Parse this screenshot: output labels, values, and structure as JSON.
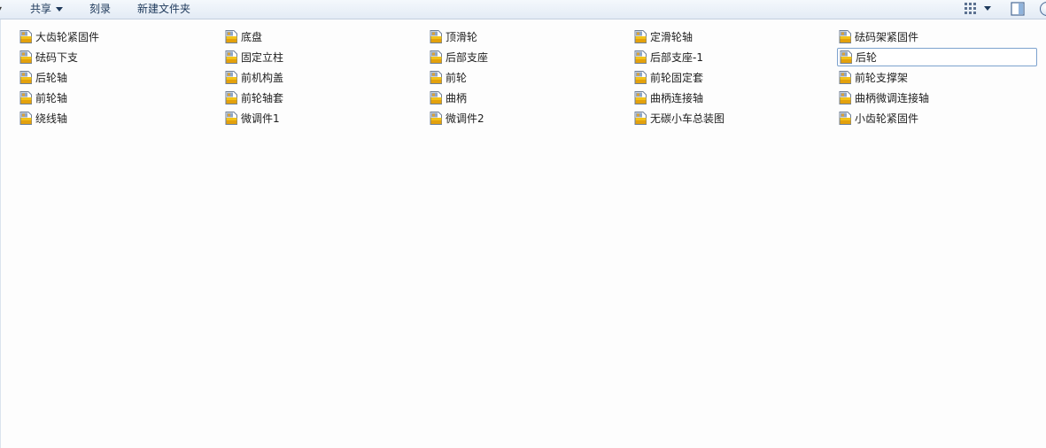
{
  "toolbar": {
    "share_label": "共享",
    "burn_label": "刻录",
    "new_folder_label": "新建文件夹"
  },
  "files": [
    {
      "name": "大齿轮紧固件"
    },
    {
      "name": "底盘"
    },
    {
      "name": "顶滑轮"
    },
    {
      "name": "定滑轮轴"
    },
    {
      "name": "砝码架紧固件"
    },
    {
      "name": "砝码下支"
    },
    {
      "name": "固定立柱"
    },
    {
      "name": "后部支座"
    },
    {
      "name": "后部支座-1"
    },
    {
      "name": "后轮",
      "selected": true
    },
    {
      "name": "后轮轴"
    },
    {
      "name": "前机构盖"
    },
    {
      "name": "前轮"
    },
    {
      "name": "前轮固定套"
    },
    {
      "name": "前轮支撑架"
    },
    {
      "name": "前轮轴"
    },
    {
      "name": "前轮轴套"
    },
    {
      "name": "曲柄"
    },
    {
      "name": "曲柄连接轴"
    },
    {
      "name": "曲柄微调连接轴"
    },
    {
      "name": "绕线轴"
    },
    {
      "name": "微调件1"
    },
    {
      "name": "微调件2"
    },
    {
      "name": "无碳小车总装图"
    },
    {
      "name": "小齿轮紧固件"
    }
  ],
  "icons": {
    "file_icon": "solidworks-part-icon",
    "view_icon": "view-grid-icon",
    "pane_icon": "preview-pane-icon",
    "help_icon": "help-icon"
  }
}
